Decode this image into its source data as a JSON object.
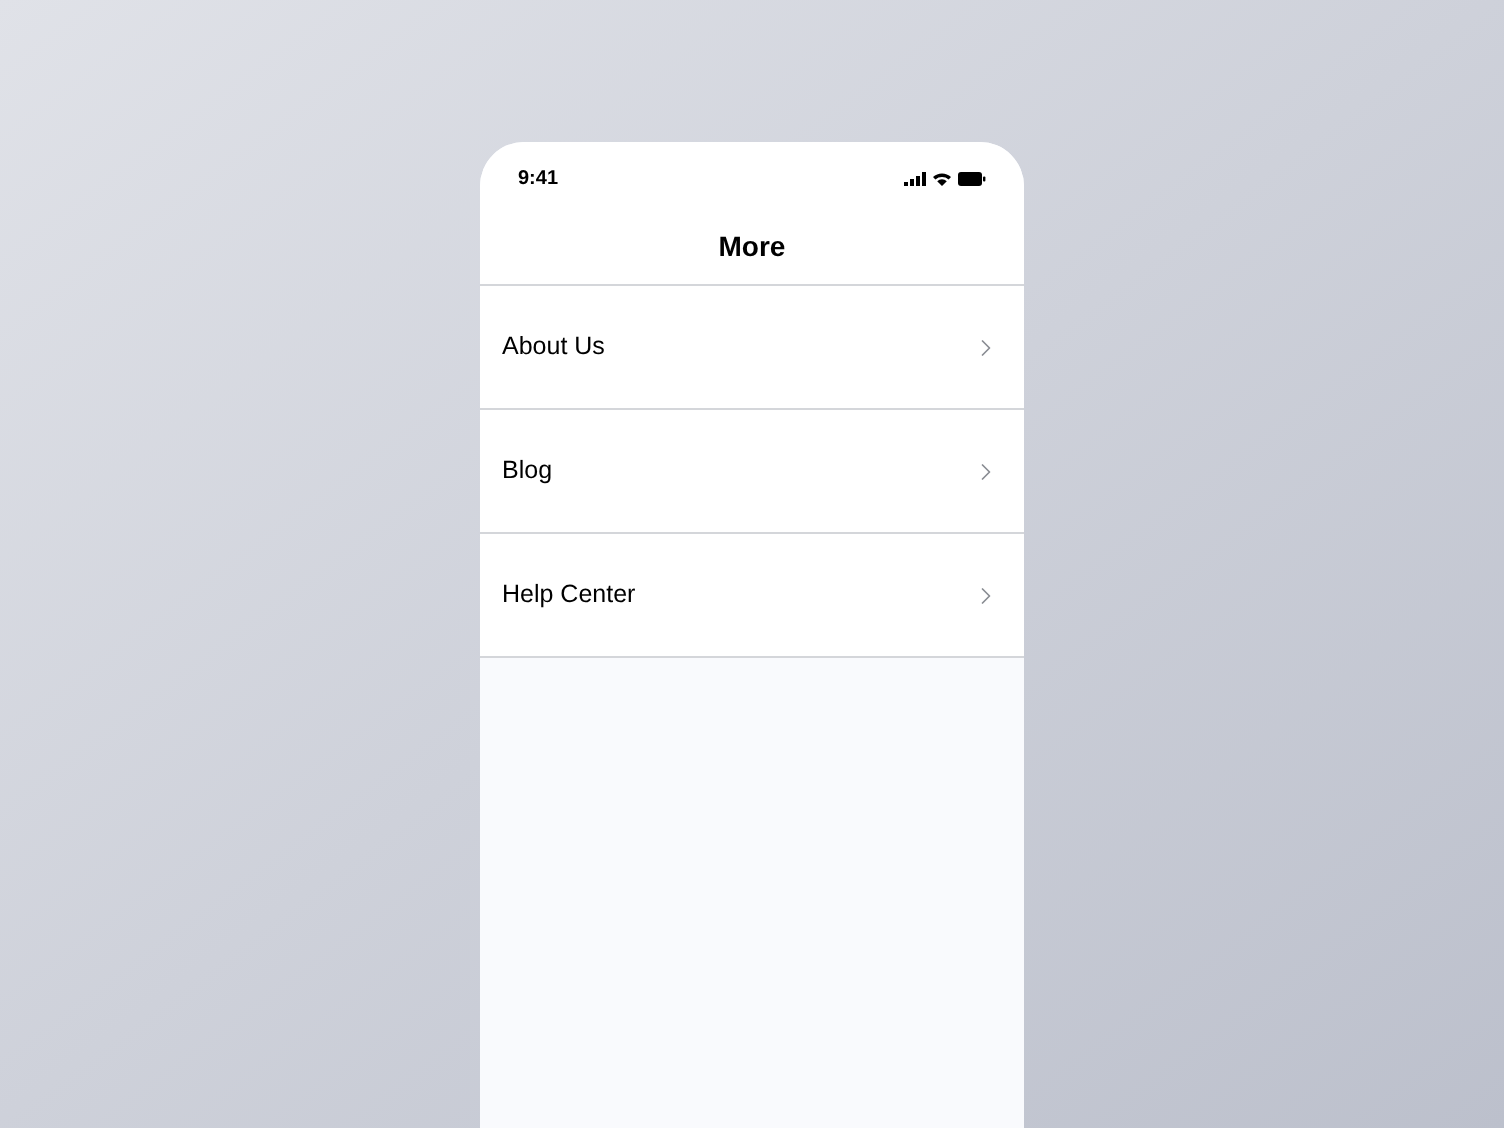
{
  "status_bar": {
    "time": "9:41"
  },
  "header": {
    "title": "More"
  },
  "menu_items": [
    {
      "label": "About Us"
    },
    {
      "label": "Blog"
    },
    {
      "label": "Help Center"
    }
  ]
}
